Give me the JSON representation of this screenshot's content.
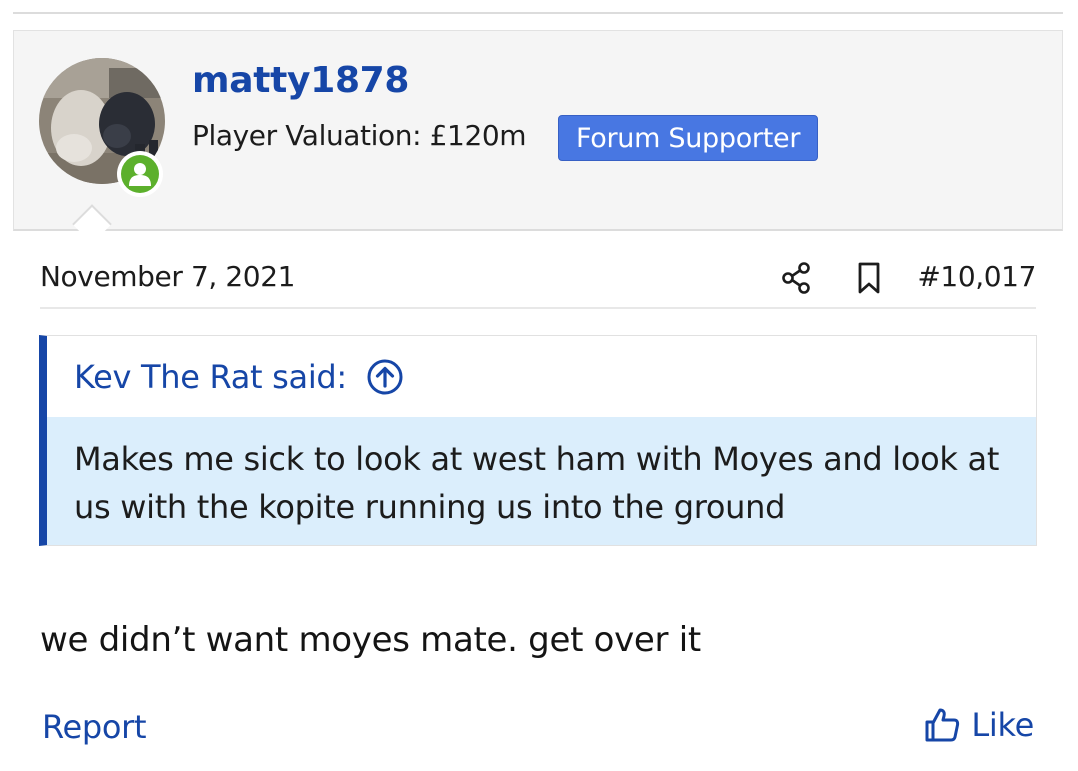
{
  "post": {
    "author": {
      "username": "matty1878",
      "valuation": "Player Valuation: £120m",
      "badge": "Forum Supporter",
      "avatar_icon": "user-avatar-dogs",
      "online_icon": "user-online-icon"
    },
    "date": "November 7, 2021",
    "actions": {
      "share_icon": "share-icon",
      "bookmark_icon": "bookmark-icon"
    },
    "number": "#10,017",
    "quote": {
      "attribution": "Kev The Rat said:",
      "expand_icon": "arrow-up-circle-icon",
      "text": "Makes me sick to look at west ham with Moyes and look at us with the kopite running us into the ground"
    },
    "body": "we didn’t want moyes mate. get over it",
    "footer": {
      "report_label": "Report",
      "like_label": "Like",
      "like_icon": "thumbs-up-icon"
    }
  },
  "colors": {
    "link": "#1646a7",
    "badge_bg": "#4877e2",
    "online": "#5cb02c",
    "quote_bg": "#dbeefc",
    "header_bg": "#f5f5f5"
  }
}
